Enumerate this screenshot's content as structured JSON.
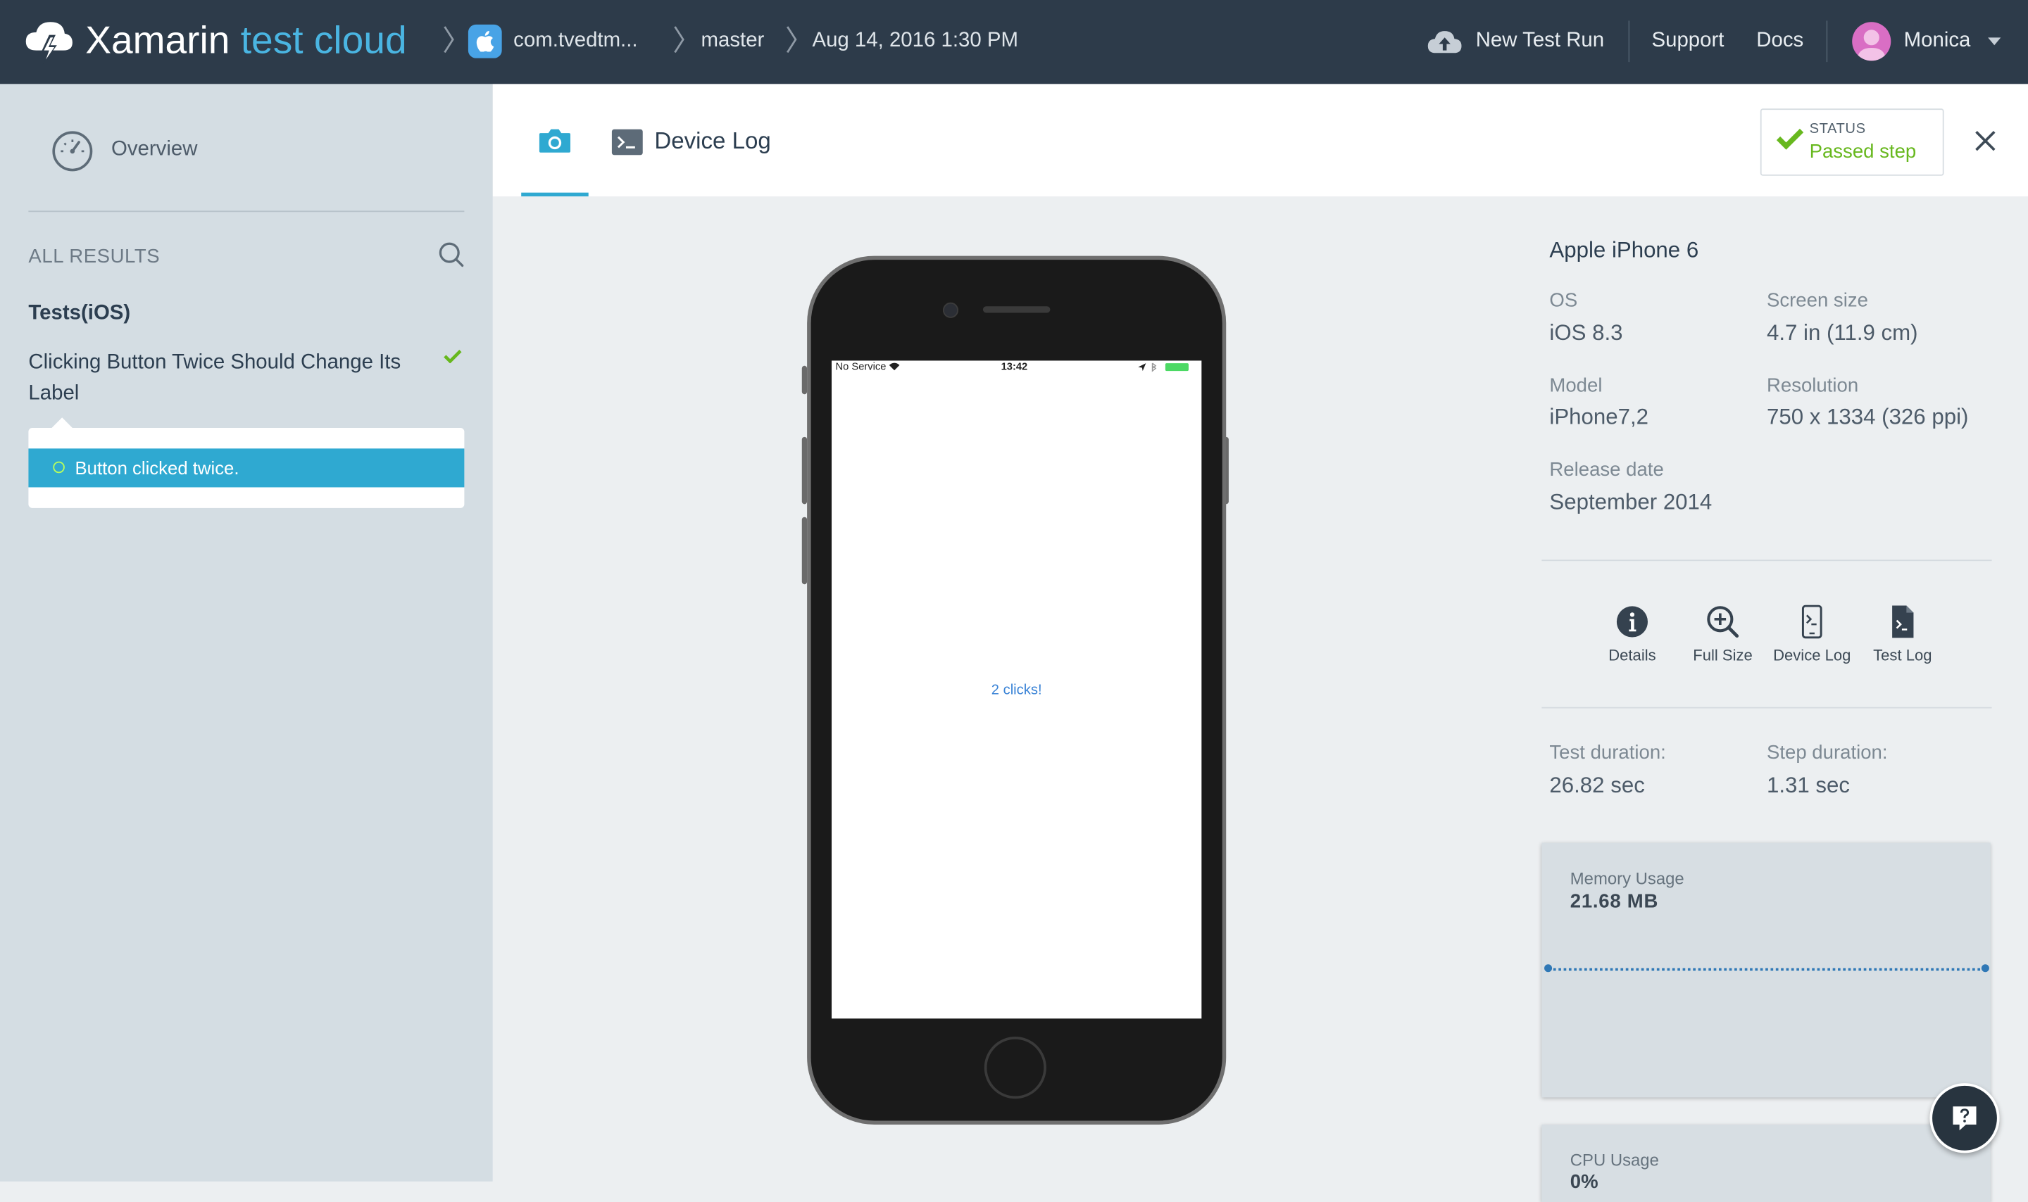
{
  "brand": {
    "word1": "Xamarin",
    "word2": "test cloud"
  },
  "breadcrumbs": {
    "app": "com.tvedtm...",
    "branch": "master",
    "date": "Aug 14, 2016 1:30 PM"
  },
  "nav": {
    "new_test_run": "New Test Run",
    "support": "Support",
    "docs": "Docs",
    "user": "Monica"
  },
  "sidebar": {
    "overview": "Overview",
    "all_results": "ALL RESULTS",
    "group": "Tests(iOS)",
    "test_name": "Clicking Button Twice Should Change Its Label",
    "step": "Button clicked twice."
  },
  "tabs": {
    "device_log": "Device Log"
  },
  "status": {
    "label": "STATUS",
    "value": "Passed step"
  },
  "phone": {
    "carrier": "No Service",
    "time": "13:42",
    "screen_text": "2 clicks!"
  },
  "device": {
    "name": "Apple iPhone 6",
    "os_label": "OS",
    "os": "iOS 8.3",
    "screen_label": "Screen size",
    "screen": "4.7 in (11.9 cm)",
    "model_label": "Model",
    "model": "iPhone7,2",
    "resolution_label": "Resolution",
    "resolution": "750 x 1334 (326 ppi)",
    "release_label": "Release date",
    "release": "September 2014"
  },
  "actions": {
    "details": "Details",
    "full_size": "Full Size",
    "device_log": "Device Log",
    "test_log": "Test Log"
  },
  "durations": {
    "test_label": "Test duration:",
    "test": "26.82 sec",
    "step_label": "Step duration:",
    "step": "1.31 sec"
  },
  "memory": {
    "label": "Memory Usage",
    "value": "21.68 MB"
  },
  "cpu": {
    "label": "CPU Usage",
    "value": "0%"
  },
  "colors": {
    "topbar": "#2d3b4a",
    "accent": "#2fa9d1",
    "success": "#67b81e",
    "brand_blue": "#4ab5e2"
  },
  "icons": [
    "xamarin-logo-icon",
    "apple-icon",
    "cloud-upload-icon",
    "caret-down-icon",
    "speedometer-icon",
    "search-icon",
    "check-icon",
    "camera-icon",
    "terminal-icon",
    "close-icon",
    "info-icon",
    "zoom-in-icon",
    "device-log-icon",
    "test-log-icon",
    "help-chat-icon"
  ]
}
